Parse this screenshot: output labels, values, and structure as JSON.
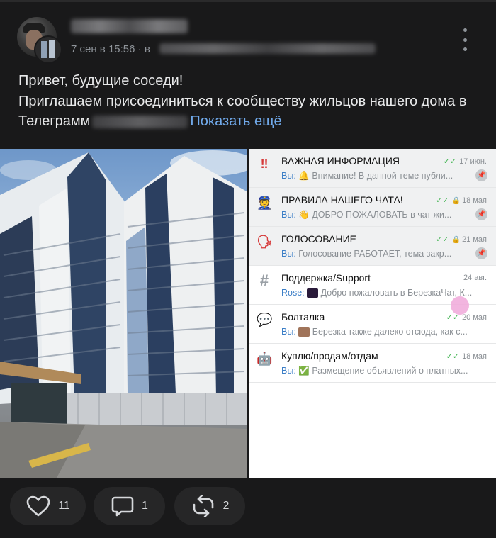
{
  "post": {
    "timestamp": "7 сен в 15:56",
    "via_prefix": "· в",
    "text_line1": "Привет, будущие соседи!",
    "text_line2": "Приглашаем присоединиться к сообществу жильцов нашего дома в",
    "text_line3_start": "Телеграмм",
    "text_line3_fragment": "...",
    "show_more": "Показать ещё"
  },
  "chat": {
    "rows": [
      {
        "title": "ВАЖНАЯ ИНФОРМАЦИЯ",
        "icon": "‼",
        "icon_name": "double-exclamation-icon",
        "date": "17 июн.",
        "checks": "✓✓",
        "lock": "",
        "sender": "Вы:",
        "emoji": "🔔",
        "preview": "Внимание! В данной теме публи...",
        "pinned": true
      },
      {
        "title": "ПРАВИЛА НАШЕГО ЧАТА!",
        "icon": "👮",
        "icon_name": "police-officer-icon",
        "date": "18 мая",
        "checks": "✓✓",
        "lock": "🔒",
        "sender": "Вы:",
        "emoji": "👋",
        "preview": "ДОБРО  ПОЖАЛОВАТЬ в чат жи...",
        "pinned": true
      },
      {
        "title": "ГОЛОСОВАНИЕ",
        "icon": "🗣",
        "icon_name": "speaking-head-icon",
        "date": "21 мая",
        "checks": "✓✓",
        "lock": "🔒",
        "sender": "Вы:",
        "emoji": "",
        "preview": "Голосование РАБОТАЕТ, тема закр...",
        "pinned": true
      },
      {
        "title": "Поддержка/Support",
        "icon": "#",
        "icon_name": "hash-icon",
        "date": "24 авг.",
        "checks": "",
        "lock": "",
        "sender": "Rose:",
        "emoji": "▪",
        "preview": "Добро пожаловать в БерезкаЧат, К...",
        "pinned": false
      },
      {
        "title": "Болталка",
        "icon": "💬",
        "icon_name": "speech-bubble-icon",
        "date": "20 мая",
        "checks": "✓✓",
        "lock": "",
        "sender": "Вы:",
        "emoji": "▬",
        "preview": "Березка также далеко отсюда, как с...",
        "pinned": false
      },
      {
        "title": "Куплю/продам/отдам",
        "icon": "🤖",
        "icon_name": "robot-icon",
        "date": "18 мая",
        "checks": "✓✓",
        "lock": "",
        "sender": "Вы:",
        "emoji": "✅",
        "preview": "Размещение объявлений о платных...",
        "pinned": false
      }
    ]
  },
  "actions": {
    "likes": "11",
    "comments": "1",
    "reposts": "2"
  },
  "colors": {
    "background": "#19191a",
    "link": "#71aaeb",
    "button": "#262627",
    "check_green": "#3fb34f",
    "sender_blue": "#3a7dc6"
  }
}
